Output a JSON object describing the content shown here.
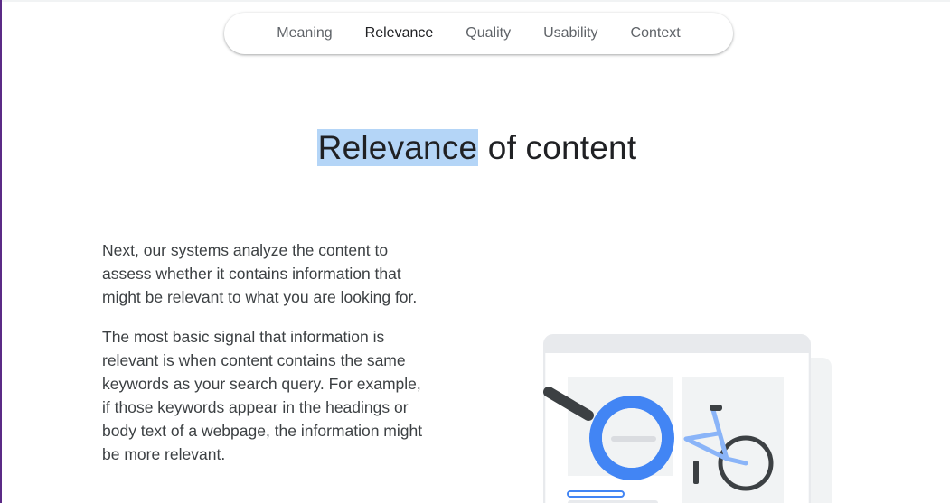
{
  "nav": {
    "items": [
      {
        "label": "Meaning",
        "active": false
      },
      {
        "label": "Relevance",
        "active": true
      },
      {
        "label": "Quality",
        "active": false
      },
      {
        "label": "Usability",
        "active": false
      },
      {
        "label": "Context",
        "active": false
      }
    ]
  },
  "heading": {
    "highlighted": "Relevance",
    "rest": " of content"
  },
  "body": {
    "paragraph_1": "Next, our systems analyze the content to assess whether it contains information that might be relevant to what you are looking for.",
    "paragraph_2": "The most basic signal that information is relevant is when content contains the same keywords as your search query. For example, if those keywords appear in the headings or body text of a webpage, the information might be more relevant."
  },
  "illustration": {
    "icon": "magnifier-bicycle-illustration",
    "colors": {
      "blue": "#4285f4",
      "light_blue": "#8ab4f8",
      "gray": "#e8eaed",
      "dark": "#3c4043"
    }
  }
}
